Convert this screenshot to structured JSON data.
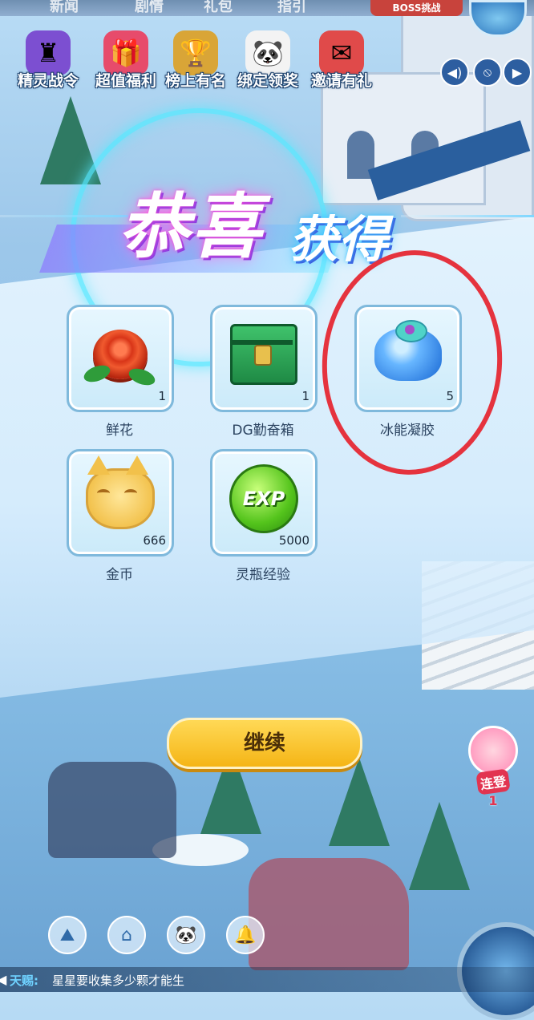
{
  "top_tabs": [
    "新闻",
    "剧情",
    "礼包",
    "指引"
  ],
  "boss_banner": "BOSS挑战",
  "nav": [
    {
      "label": "精灵战令",
      "icon": "trophy-icon"
    },
    {
      "label": "超值福利",
      "icon": "gift-icon"
    },
    {
      "label": "榜上有名",
      "icon": "cup-icon"
    },
    {
      "label": "绑定领奖",
      "icon": "panda-icon"
    },
    {
      "label": "邀请有礼",
      "icon": "invite-icon"
    }
  ],
  "side_buttons": [
    "◀)",
    "⦸",
    "▶"
  ],
  "title": {
    "part1": "恭喜",
    "part2": "获得"
  },
  "rewards": [
    {
      "name": "鲜花",
      "count": "1",
      "icon": "rose-icon"
    },
    {
      "name": "DG勤奋箱",
      "count": "1",
      "icon": "chest-icon"
    },
    {
      "name": "冰能凝胶",
      "count": "5",
      "icon": "ice-gel-icon"
    },
    {
      "name": "金币",
      "count": "666",
      "icon": "coin-cat-icon"
    },
    {
      "name": "灵瓶经验",
      "count": "5000",
      "icon": "exp-orb-icon"
    }
  ],
  "exp_text": "EXP",
  "continue_label": "继续",
  "event": {
    "label": "连登",
    "num": "1"
  },
  "ticker": {
    "label": "天赐:",
    "text": "星星要收集多少颗才能生"
  },
  "colors": {
    "continue": "#f5b516",
    "highlight": "#e5333e",
    "title_glow": "#ff4fd8"
  }
}
